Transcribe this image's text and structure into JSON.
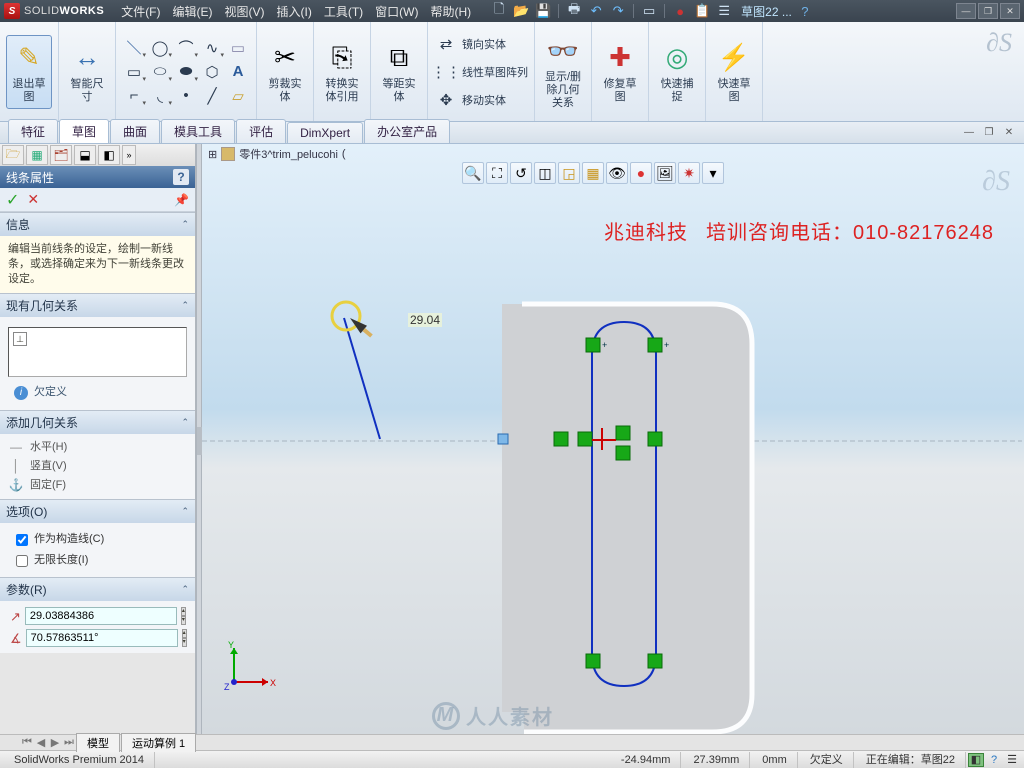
{
  "title": {
    "brand_light": "SOLID",
    "brand_bold": "WORKS"
  },
  "menu": {
    "file": "文件(F)",
    "edit": "编辑(E)",
    "view": "视图(V)",
    "insert": "插入(I)",
    "tools": "工具(T)",
    "window": "窗口(W)",
    "help": "帮助(H)"
  },
  "quick": {
    "docname": "草图22 ..."
  },
  "ribbon": {
    "exit_sketch": "退出草\n图",
    "smart_dim": "智能尺\n寸",
    "trim": "剪裁实\n体",
    "convert": "转换实\n体引用",
    "offset": "等距实\n体",
    "mirror": "镜向实体",
    "linear_pattern": "线性草图阵列",
    "move": "移动实体",
    "show_hide": "显示/删\n除几何\n关系",
    "repair": "修复草\n图",
    "quick_snap": "快速捕\n捉",
    "rapid_sketch": "快速草\n图"
  },
  "maintabs": {
    "features": "特征",
    "sketch": "草图",
    "surfaces": "曲面",
    "mold": "模具工具",
    "evaluate": "评估",
    "dimxpert": "DimXpert",
    "office": "办公室产品"
  },
  "crumb": {
    "name": "零件3^trim_pelucohi",
    "extra": "("
  },
  "prop": {
    "title": "线条属性",
    "info_head": "信息",
    "info_body": "编辑当前线条的设定，绘制一新线条，或选择确定来为下一新线条更改设定。",
    "existing_head": "现有几何关系",
    "underdefined": "欠定义",
    "add_head": "添加几何关系",
    "horiz": "水平(H)",
    "vert": "竖直(V)",
    "fix": "固定(F)",
    "options_head": "选项(O)",
    "as_construction": "作为构造线(C)",
    "infinite": "无限长度(I)",
    "params_head": "参数(R)",
    "length_val": "29.03884386",
    "angle_val": "70.57863511°"
  },
  "canvas": {
    "dim_value": "29.04",
    "watermark_company": "兆迪科技",
    "watermark_phone": "培训咨询电话：010-82176248",
    "rrsc": "人人素材"
  },
  "viewtabs": {
    "model": "模型",
    "motion": "运动算例 1"
  },
  "status": {
    "product": "SolidWorks Premium 2014",
    "x": "-24.94mm",
    "y": "27.39mm",
    "z": "0mm",
    "state": "欠定义",
    "editing": "正在编辑：草图22"
  }
}
